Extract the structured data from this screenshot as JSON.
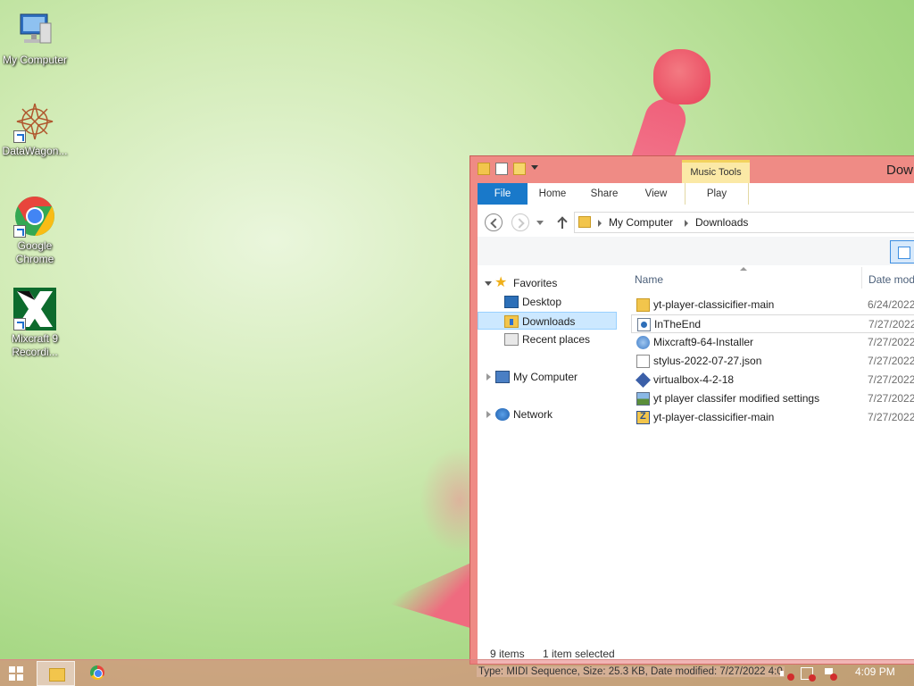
{
  "desktop": {
    "icons": [
      {
        "label": "My Computer",
        "icon": "computer-icon"
      },
      {
        "label": "DataWagon...",
        "icon": "datawagon-icon"
      },
      {
        "label": "Google Chrome",
        "icon": "chrome-icon"
      },
      {
        "label": "Mixcraft 9 Recordi...",
        "icon": "mixcraft-icon"
      }
    ]
  },
  "window": {
    "title": "Dow",
    "context_tab": "Music Tools",
    "ribbon_tabs": [
      "File",
      "Home",
      "Share",
      "View",
      "Play"
    ],
    "breadcrumb": [
      "My Computer",
      "Downloads"
    ],
    "nav_pane": [
      {
        "label": "Favorites",
        "icon": "star-icon",
        "expanded": true
      },
      {
        "label": "Desktop",
        "icon": "desktop-icon"
      },
      {
        "label": "Downloads",
        "icon": "downloads-folder-icon",
        "selected": true
      },
      {
        "label": "Recent places",
        "icon": "recent-places-icon"
      },
      {
        "label": "My Computer",
        "icon": "computer-icon",
        "expanded": false
      },
      {
        "label": "Network",
        "icon": "network-icon",
        "expanded": false
      }
    ],
    "columns": {
      "name": "Name",
      "date": "Date mod"
    },
    "files": [
      {
        "name": "yt-player-classicifier-main",
        "date": "6/24/2022",
        "icon": "folder-icon"
      },
      {
        "name": "InTheEnd",
        "date": "7/27/2022",
        "icon": "midi-file-icon",
        "selected": true
      },
      {
        "name": "Mixcraft9-64-Installer",
        "date": "7/27/2022",
        "icon": "installer-icon"
      },
      {
        "name": "stylus-2022-07-27.json",
        "date": "7/27/2022",
        "icon": "json-file-icon"
      },
      {
        "name": "virtualbox-4-2-18",
        "date": "7/27/2022",
        "icon": "virtualbox-icon"
      },
      {
        "name": "yt player classifer modified settings",
        "date": "7/27/2022",
        "icon": "image-file-icon"
      },
      {
        "name": "yt-player-classicifier-main",
        "date": "7/27/2022",
        "icon": "zip-file-icon"
      }
    ],
    "status": {
      "count": "9 items",
      "selected": "1 item selected"
    }
  },
  "taskbar": {
    "status_tooltip": "Type: MIDI Sequence, Size: 25.3 KB, Date modified: 7/27/2022 4:0",
    "clock": "4:09 PM"
  },
  "colors": {
    "window_frame": "#ef8b85",
    "file_tab": "#1979ca",
    "context_tab": "#fbe9a6",
    "selection": "#cce8ff"
  }
}
